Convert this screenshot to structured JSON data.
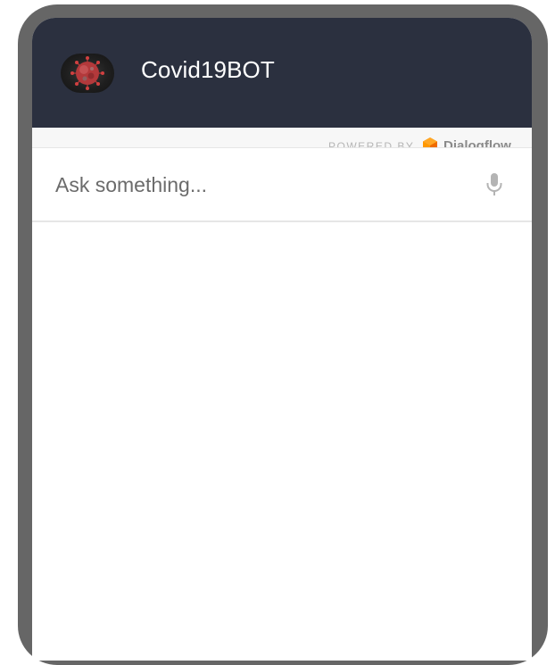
{
  "header": {
    "title": "Covid19BOT",
    "background_color": "#2b303f",
    "avatar_icon": "virus-icon"
  },
  "branding": {
    "powered_by": "POWERED BY",
    "provider": "Dialogflow",
    "provider_icon": "dialogflow-logo-icon",
    "provider_color": "#ff9800"
  },
  "input": {
    "placeholder": "Ask something...",
    "value": "",
    "mic_icon": "microphone-icon"
  },
  "frame": {
    "color": "#666666"
  }
}
